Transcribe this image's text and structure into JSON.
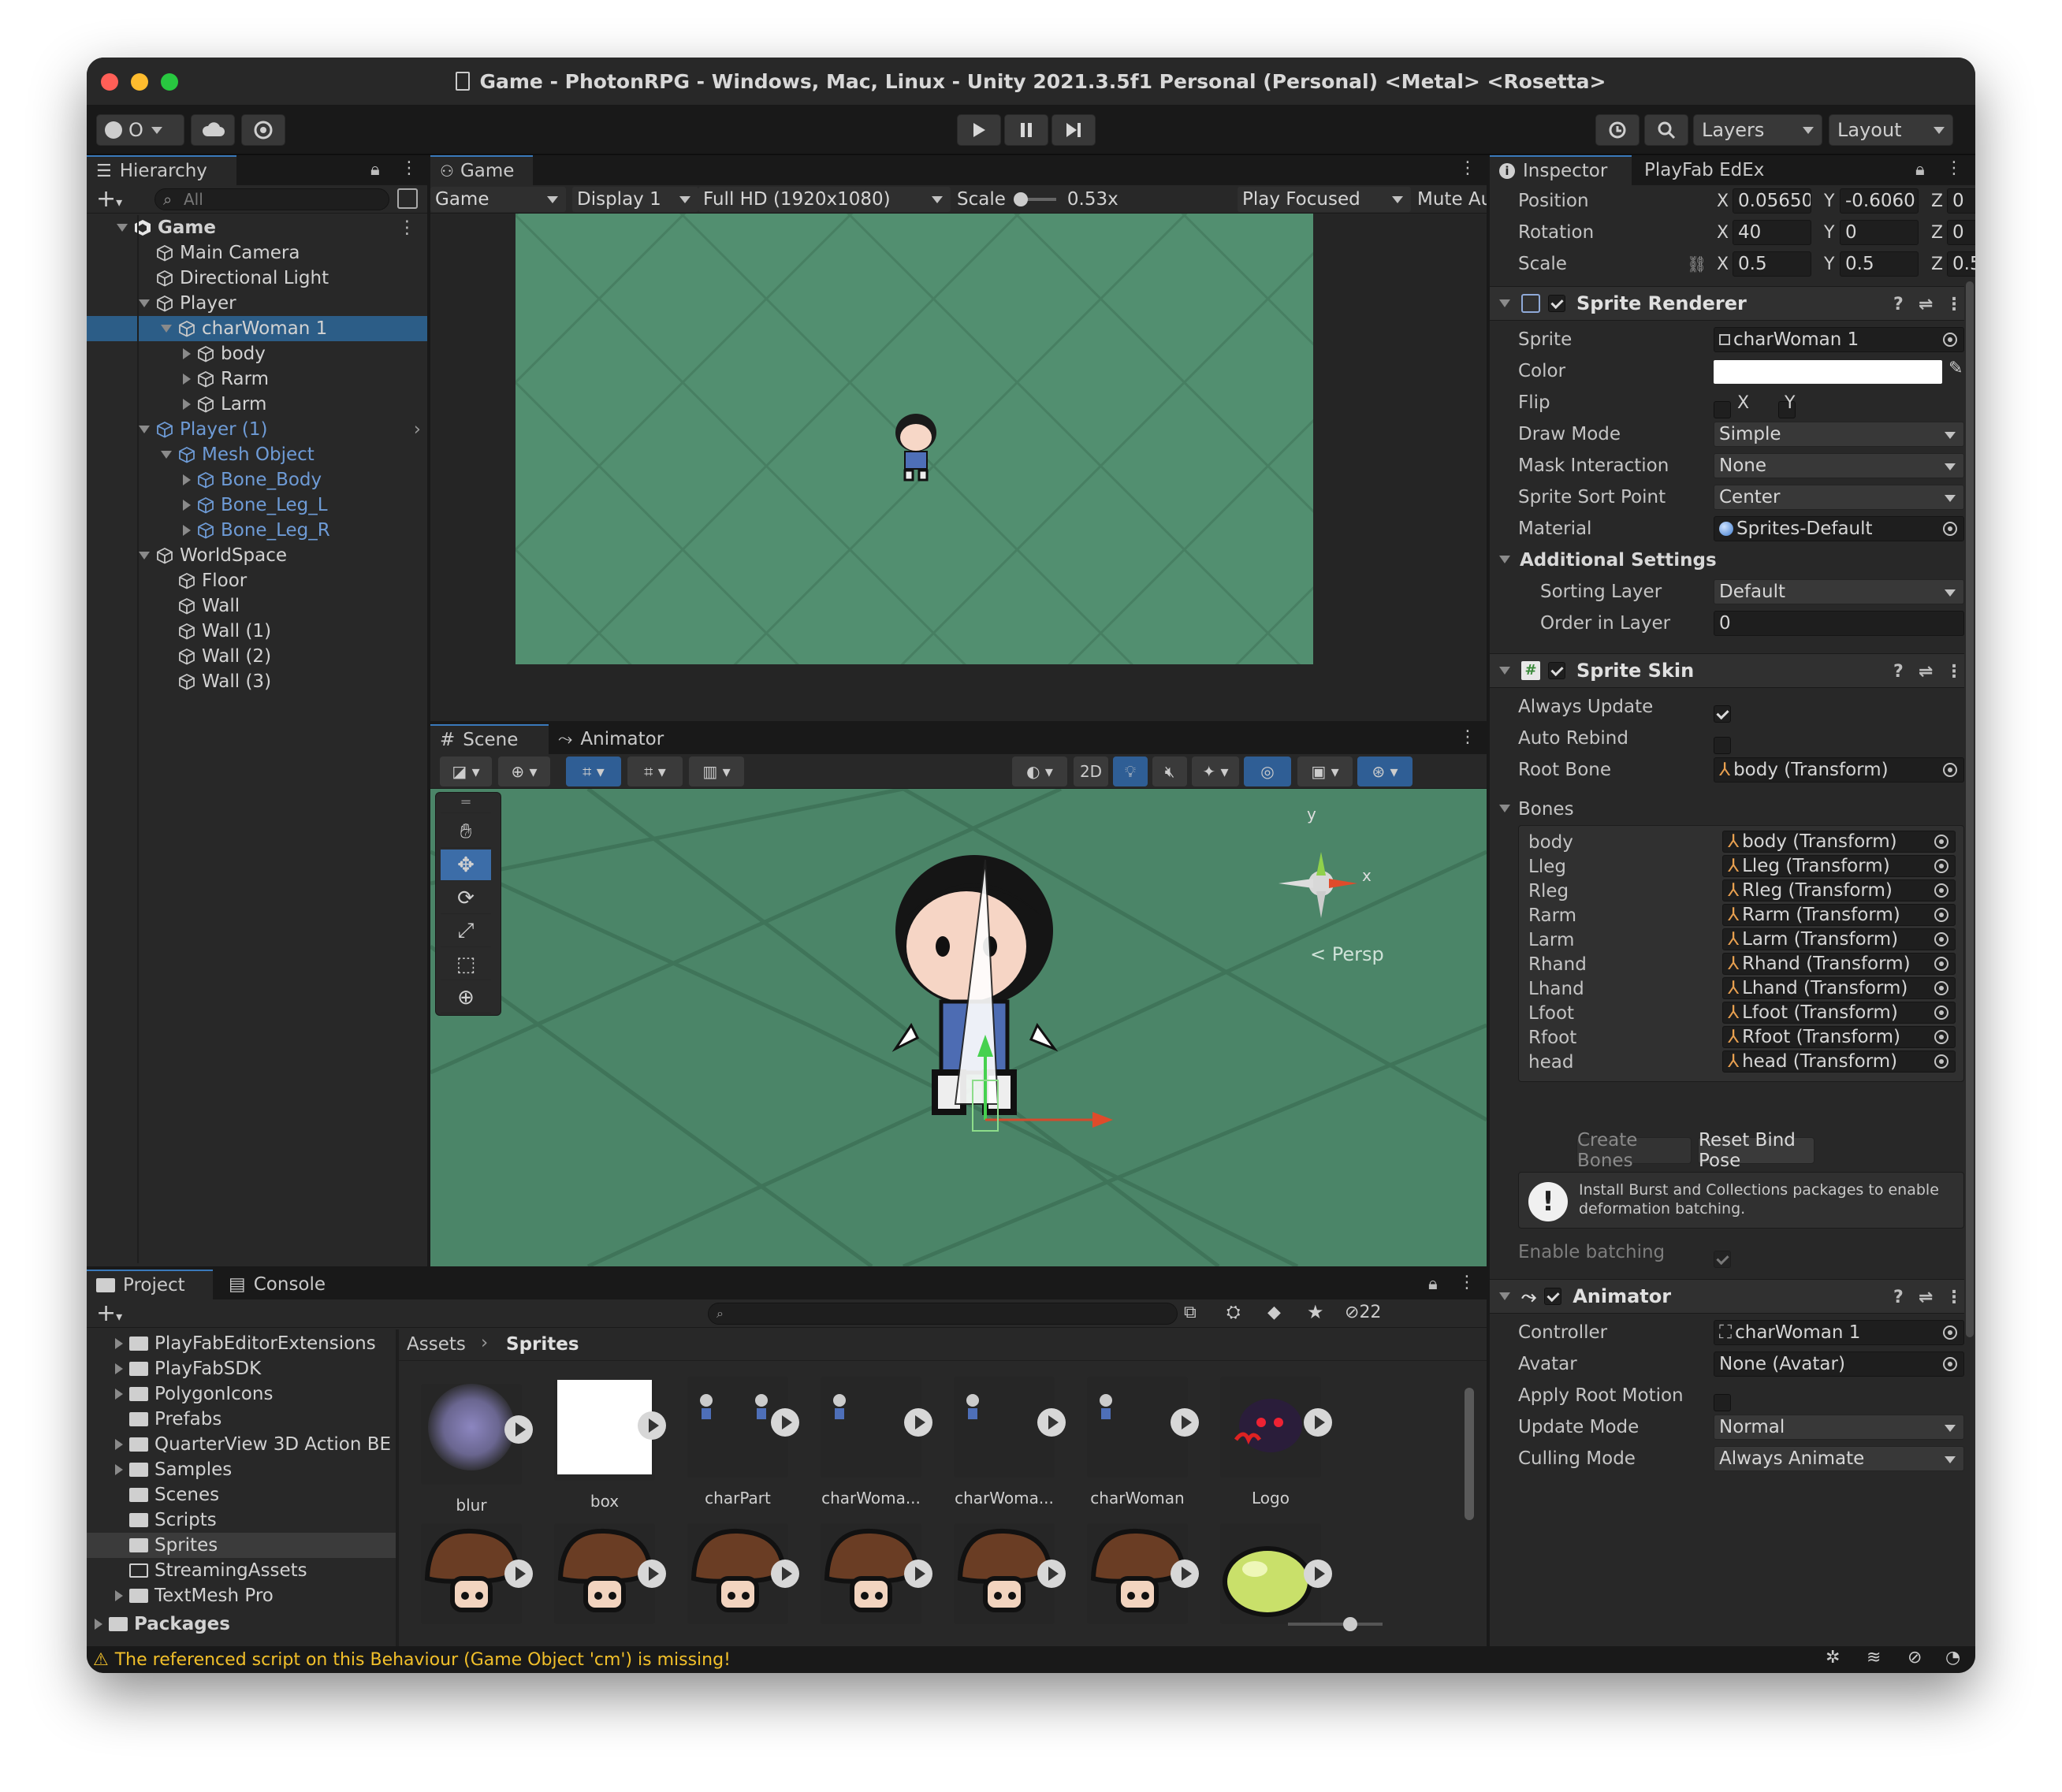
{
  "window": {
    "title": "Game - PhotonRPG - Windows, Mac, Linux - Unity 2021.3.5f1 Personal (Personal) <Metal> <Rosetta>"
  },
  "toolbar": {
    "account_label": "O",
    "layers_label": "Layers",
    "layout_label": "Layout"
  },
  "hierarchy": {
    "tab": "Hierarchy",
    "search_placeholder": "All",
    "items": [
      {
        "label": "Game",
        "depth": 0,
        "kind": "scene",
        "expanded": true
      },
      {
        "label": "Main Camera",
        "depth": 1,
        "kind": "go"
      },
      {
        "label": "Directional Light",
        "depth": 1,
        "kind": "go"
      },
      {
        "label": "Player",
        "depth": 1,
        "kind": "go",
        "expanded": true
      },
      {
        "label": "charWoman 1",
        "depth": 2,
        "kind": "go",
        "expanded": true,
        "selected": true
      },
      {
        "label": "body",
        "depth": 3,
        "kind": "go",
        "collapsed": true
      },
      {
        "label": "Rarm",
        "depth": 3,
        "kind": "go",
        "collapsed": true
      },
      {
        "label": "Larm",
        "depth": 3,
        "kind": "go",
        "collapsed": true
      },
      {
        "label": "Player (1)",
        "depth": 1,
        "kind": "prefab",
        "expanded": true
      },
      {
        "label": "Mesh Object",
        "depth": 2,
        "kind": "prefab",
        "expanded": true
      },
      {
        "label": "Bone_Body",
        "depth": 3,
        "kind": "prefab",
        "collapsed": true
      },
      {
        "label": "Bone_Leg_L",
        "depth": 3,
        "kind": "prefab",
        "collapsed": true
      },
      {
        "label": "Bone_Leg_R",
        "depth": 3,
        "kind": "prefab",
        "collapsed": true
      },
      {
        "label": "WorldSpace",
        "depth": 1,
        "kind": "go",
        "expanded": true
      },
      {
        "label": "Floor",
        "depth": 2,
        "kind": "go"
      },
      {
        "label": "Wall",
        "depth": 2,
        "kind": "go"
      },
      {
        "label": "Wall (1)",
        "depth": 2,
        "kind": "go"
      },
      {
        "label": "Wall (2)",
        "depth": 2,
        "kind": "go"
      },
      {
        "label": "Wall (3)",
        "depth": 2,
        "kind": "go"
      }
    ]
  },
  "game": {
    "tab": "Game",
    "mode": "Game",
    "display": "Display 1",
    "resolution": "Full HD (1920x1080)",
    "scale_label": "Scale",
    "scale_value": "0.53x",
    "play_focus": "Play Focused",
    "mute": "Mute Au"
  },
  "scene": {
    "tabs": [
      "Scene",
      "Animator"
    ],
    "btn_2d": "2D",
    "gizmo_y": "y",
    "gizmo_x": "x",
    "persp": "Persp"
  },
  "project": {
    "tabs": [
      "Project",
      "Console"
    ],
    "count": "22",
    "folders": [
      {
        "label": "PlayFabEditorExtensions",
        "expandable": true
      },
      {
        "label": "PlayFabSDK",
        "expandable": true
      },
      {
        "label": "PolygonIcons",
        "expandable": true
      },
      {
        "label": "Prefabs",
        "expandable": false
      },
      {
        "label": "QuarterView 3D Action BE",
        "expandable": true
      },
      {
        "label": "Samples",
        "expandable": true
      },
      {
        "label": "Scenes",
        "expandable": false
      },
      {
        "label": "Scripts",
        "expandable": false
      },
      {
        "label": "Sprites",
        "expandable": false,
        "selected": true
      },
      {
        "label": "StreamingAssets",
        "expandable": false
      },
      {
        "label": "TextMesh Pro",
        "expandable": true
      }
    ],
    "packages": "Packages",
    "breadcrumb": [
      "Assets",
      "Sprites"
    ],
    "assets": [
      "blur",
      "box",
      "charPart",
      "charWoma...",
      "charWoma...",
      "charWoman",
      "Logo"
    ]
  },
  "inspector": {
    "tabs": [
      "Inspector",
      "PlayFab EdEx"
    ],
    "transform": {
      "position": {
        "label": "Position",
        "x": "0.05650",
        "y": "-0.6060",
        "z": "0"
      },
      "rotation": {
        "label": "Rotation",
        "x": "40",
        "y": "0",
        "z": "0"
      },
      "scale": {
        "label": "Scale",
        "x": "0.5",
        "y": "0.5",
        "z": "0.5"
      }
    },
    "sprite_renderer": {
      "title": "Sprite Renderer",
      "sprite": {
        "label": "Sprite",
        "value": "charWoman 1"
      },
      "color": {
        "label": "Color",
        "value": "#ffffff"
      },
      "flip": {
        "label": "Flip",
        "x": "X",
        "y": "Y"
      },
      "draw_mode": {
        "label": "Draw Mode",
        "value": "Simple"
      },
      "mask": {
        "label": "Mask Interaction",
        "value": "None"
      },
      "sort_point": {
        "label": "Sprite Sort Point",
        "value": "Center"
      },
      "material": {
        "label": "Material",
        "value": "Sprites-Default"
      },
      "additional": "Additional Settings",
      "sorting_layer": {
        "label": "Sorting Layer",
        "value": "Default"
      },
      "order": {
        "label": "Order in Layer",
        "value": "0"
      }
    },
    "sprite_skin": {
      "title": "Sprite Skin",
      "always_update": "Always Update",
      "auto_rebind": "Auto Rebind",
      "root_bone": {
        "label": "Root Bone",
        "value": "body (Transform)"
      },
      "bones_label": "Bones",
      "bones": [
        {
          "name": "body",
          "value": "body (Transform)"
        },
        {
          "name": "Lleg",
          "value": "Lleg (Transform)"
        },
        {
          "name": "Rleg",
          "value": "Rleg (Transform)"
        },
        {
          "name": "Rarm",
          "value": "Rarm (Transform)"
        },
        {
          "name": "Larm",
          "value": "Larm (Transform)"
        },
        {
          "name": "Rhand",
          "value": "Rhand (Transform)"
        },
        {
          "name": "Lhand",
          "value": "Lhand (Transform)"
        },
        {
          "name": "Lfoot",
          "value": "Lfoot (Transform)"
        },
        {
          "name": "Rfoot",
          "value": "Rfoot (Transform)"
        },
        {
          "name": "head",
          "value": "head (Transform)"
        }
      ],
      "create_bones": "Create Bones",
      "reset_bind": "Reset Bind Pose",
      "info": "Install Burst and Collections packages to enable deformation batching.",
      "enable_batching": "Enable batching"
    },
    "animator": {
      "title": "Animator",
      "controller": {
        "label": "Controller",
        "value": "charWoman 1"
      },
      "avatar": {
        "label": "Avatar",
        "value": "None (Avatar)"
      },
      "root_motion": "Apply Root Motion",
      "update_mode": {
        "label": "Update Mode",
        "value": "Normal"
      },
      "culling_mode": {
        "label": "Culling Mode",
        "value": "Always Animate"
      }
    }
  },
  "status": {
    "message": "The referenced script on this Behaviour (Game Object 'cm') is missing!"
  },
  "colors": {
    "accent": "#3a79bb",
    "selection": "#2c5d87",
    "prefab": "#6e9bd6",
    "warning": "#f2c02a",
    "floor": "#4f8a6f"
  }
}
